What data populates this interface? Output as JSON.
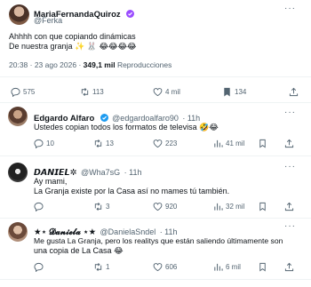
{
  "tweet": {
    "author_name": "MariaFernandaQuiroz",
    "handle": "@Ferka",
    "line1": "Ahhhh con que copiando dinámicas",
    "line2": "De nuestra granja ✨ 🐰 😂😂😂😂",
    "time": "20:38 · 23 ago 2026 · ",
    "views": "349,1 mil",
    "views_label": " Reproducciones",
    "replies": "575",
    "retweets": "113",
    "likes": "4 mil",
    "bookmarks": "134"
  },
  "replies": [
    {
      "name": "Edgardo Alfaro",
      "handle": "@edgardoalfaro90",
      "time": "· 11h",
      "text": "Ustedes copian todos los formatos de televisa 🤣😂",
      "replies": "10",
      "retweets": "13",
      "likes": "223",
      "views": "41 mil"
    },
    {
      "name": "𝘿𝘼𝙉𝙄𝙀𝙇✲",
      "handle": "@Wha7sG",
      "time": "· 11h",
      "text_line1": "Ay mami,",
      "text_line2": "La Granja existe por la Casa así no mames tú también.",
      "replies": "",
      "retweets": "3",
      "likes": "920",
      "views": "32 mil"
    },
    {
      "name": "★⋆ 𝓓𝓪𝓷𝓲𝓮𝓵𝓪 ⋆★",
      "handle": "@DanielaSndel",
      "time": "· 11h",
      "text_line1": "Me gusta La Granja, pero los realitys que están saliendo últimamente son",
      "text_line2": "una copia de La Casa 😂",
      "replies": "",
      "retweets": "1",
      "likes": "606",
      "views": "6 mil"
    }
  ],
  "colors": {
    "verified": "#9b4dff",
    "verified_blue": "#1d9bf0",
    "secondary": "#536471"
  }
}
